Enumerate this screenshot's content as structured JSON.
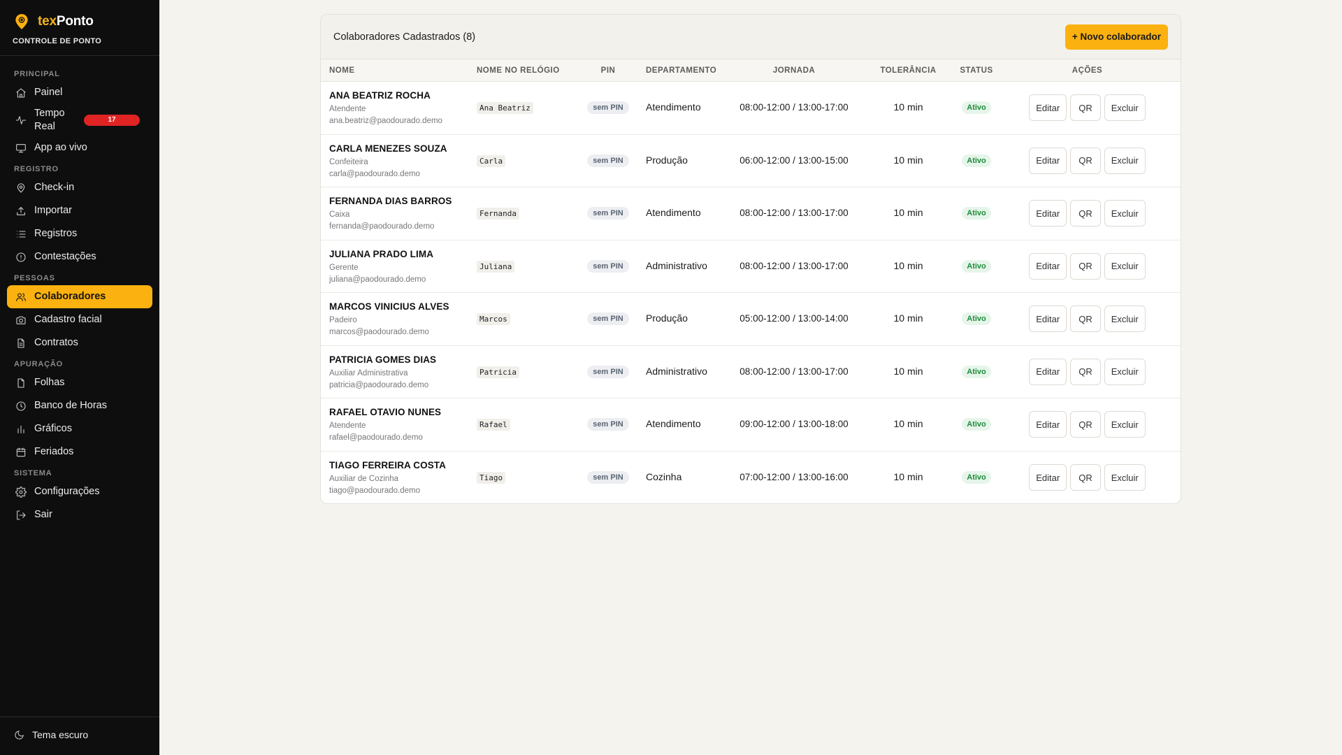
{
  "brand": {
    "name_part1": "tex",
    "name_part2": "Ponto",
    "subtitle": "CONTROLE DE PONTO",
    "accent": "#fbb10f"
  },
  "sidebar": {
    "sections": [
      {
        "label": "PRINCIPAL",
        "items": [
          {
            "label": "Painel",
            "icon": "home-icon"
          },
          {
            "label": "Tempo Real",
            "icon": "activity-icon",
            "badge": "17"
          },
          {
            "label": "App ao vivo",
            "icon": "monitor-icon"
          }
        ]
      },
      {
        "label": "REGISTRO",
        "items": [
          {
            "label": "Check-in",
            "icon": "map-pin-icon"
          },
          {
            "label": "Importar",
            "icon": "upload-icon"
          },
          {
            "label": "Registros",
            "icon": "list-icon"
          },
          {
            "label": "Contestações",
            "icon": "alert-circle-icon"
          }
        ]
      },
      {
        "label": "PESSOAS",
        "items": [
          {
            "label": "Colaboradores",
            "icon": "users-icon",
            "active": true
          },
          {
            "label": "Cadastro facial",
            "icon": "camera-icon"
          },
          {
            "label": "Contratos",
            "icon": "file-text-icon"
          }
        ]
      },
      {
        "label": "APURAÇÃO",
        "items": [
          {
            "label": "Folhas",
            "icon": "file-icon"
          },
          {
            "label": "Banco de Horas",
            "icon": "clock-icon"
          },
          {
            "label": "Gráficos",
            "icon": "bar-chart-icon"
          },
          {
            "label": "Feriados",
            "icon": "calendar-icon"
          }
        ]
      },
      {
        "label": "SISTEMA",
        "items": [
          {
            "label": "Configurações",
            "icon": "gear-icon"
          },
          {
            "label": "Sair",
            "icon": "log-out-icon"
          }
        ]
      }
    ],
    "theme_toggle": "Tema escuro"
  },
  "card": {
    "title": "Colaboradores Cadastrados (8)",
    "new_button": "+ Novo colaborador"
  },
  "table": {
    "columns": [
      "NOME",
      "NOME NO RELÓGIO",
      "PIN",
      "DEPARTAMENTO",
      "JORNADA",
      "TOLERÂNCIA",
      "STATUS",
      "AÇÕES"
    ],
    "actions": {
      "edit": "Editar",
      "qr": "QR",
      "delete": "Excluir"
    },
    "rows": [
      {
        "name": "ANA BEATRIZ ROCHA",
        "role": "Atendente",
        "email": "ana.beatriz@paodourado.demo",
        "clock_name": "Ana Beatriz",
        "pin": "sem PIN",
        "department": "Atendimento",
        "schedule": "08:00-12:00 / 13:00-17:00",
        "tolerance": "10 min",
        "status": "Ativo"
      },
      {
        "name": "CARLA MENEZES SOUZA",
        "role": "Confeiteira",
        "email": "carla@paodourado.demo",
        "clock_name": "Carla",
        "pin": "sem PIN",
        "department": "Produção",
        "schedule": "06:00-12:00 / 13:00-15:00",
        "tolerance": "10 min",
        "status": "Ativo"
      },
      {
        "name": "FERNANDA DIAS BARROS",
        "role": "Caixa",
        "email": "fernanda@paodourado.demo",
        "clock_name": "Fernanda",
        "pin": "sem PIN",
        "department": "Atendimento",
        "schedule": "08:00-12:00 / 13:00-17:00",
        "tolerance": "10 min",
        "status": "Ativo"
      },
      {
        "name": "JULIANA PRADO LIMA",
        "role": "Gerente",
        "email": "juliana@paodourado.demo",
        "clock_name": "Juliana",
        "pin": "sem PIN",
        "department": "Administrativo",
        "schedule": "08:00-12:00 / 13:00-17:00",
        "tolerance": "10 min",
        "status": "Ativo"
      },
      {
        "name": "MARCOS VINICIUS ALVES",
        "role": "Padeiro",
        "email": "marcos@paodourado.demo",
        "clock_name": "Marcos",
        "pin": "sem PIN",
        "department": "Produção",
        "schedule": "05:00-12:00 / 13:00-14:00",
        "tolerance": "10 min",
        "status": "Ativo"
      },
      {
        "name": "PATRICIA GOMES DIAS",
        "role": "Auxiliar Administrativa",
        "email": "patricia@paodourado.demo",
        "clock_name": "Patricia",
        "pin": "sem PIN",
        "department": "Administrativo",
        "schedule": "08:00-12:00 / 13:00-17:00",
        "tolerance": "10 min",
        "status": "Ativo"
      },
      {
        "name": "RAFAEL OTAVIO NUNES",
        "role": "Atendente",
        "email": "rafael@paodourado.demo",
        "clock_name": "Rafael",
        "pin": "sem PIN",
        "department": "Atendimento",
        "schedule": "09:00-12:00 / 13:00-18:00",
        "tolerance": "10 min",
        "status": "Ativo"
      },
      {
        "name": "TIAGO FERREIRA COSTA",
        "role": "Auxiliar de Cozinha",
        "email": "tiago@paodourado.demo",
        "clock_name": "Tiago",
        "pin": "sem PIN",
        "department": "Cozinha",
        "schedule": "07:00-12:00 / 13:00-16:00",
        "tolerance": "10 min",
        "status": "Ativo"
      }
    ]
  }
}
